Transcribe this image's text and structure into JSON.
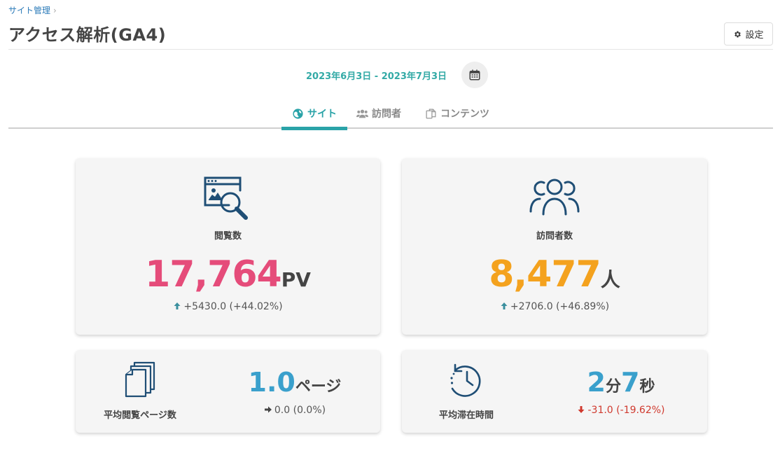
{
  "breadcrumb": {
    "parent": "サイト管理",
    "separator": "›"
  },
  "page": {
    "title": "アクセス解析(GA4)"
  },
  "settings_button": {
    "label": "設定",
    "icon": "gear-icon"
  },
  "date_range": {
    "label": "2023年6月3日 - 2023年7月3日",
    "icon": "calendar-icon"
  },
  "tabs": [
    {
      "label": "サイト",
      "icon": "globe-icon",
      "active": true
    },
    {
      "label": "訪問者",
      "icon": "users-icon",
      "active": false
    },
    {
      "label": "コンテンツ",
      "icon": "copy-icon",
      "active": false
    }
  ],
  "colors": {
    "accent": "#2aa3a8",
    "pageviews": "#e54c7a",
    "visitors": "#f4a21e",
    "metric_blue": "#3aa0cc",
    "increase": "#3a8f9e",
    "decrease": "#d0392e"
  },
  "metrics": {
    "pageviews": {
      "label": "閲覧数",
      "value": "17,764",
      "unit": "PV",
      "change": "+5430.0 (+44.02%)",
      "trend": "up",
      "icon": "browser-search-icon"
    },
    "visitors": {
      "label": "訪問者数",
      "value": "8,477",
      "unit": "人",
      "change": "+2706.0 (+46.89%)",
      "trend": "up",
      "icon": "people-group-icon"
    },
    "pages_per_visit": {
      "label": "平均閲覧ページ数",
      "value": "1.0",
      "unit": "ページ",
      "change": "0.0 (0.0%)",
      "trend": "flat",
      "icon": "pages-stack-icon"
    },
    "avg_duration": {
      "label": "平均滞在時間",
      "minutes": "2",
      "minutes_unit": "分",
      "seconds": "7",
      "seconds_unit": "秒",
      "change": "-31.0 (-19.62%)",
      "trend": "down",
      "icon": "history-clock-icon"
    }
  }
}
